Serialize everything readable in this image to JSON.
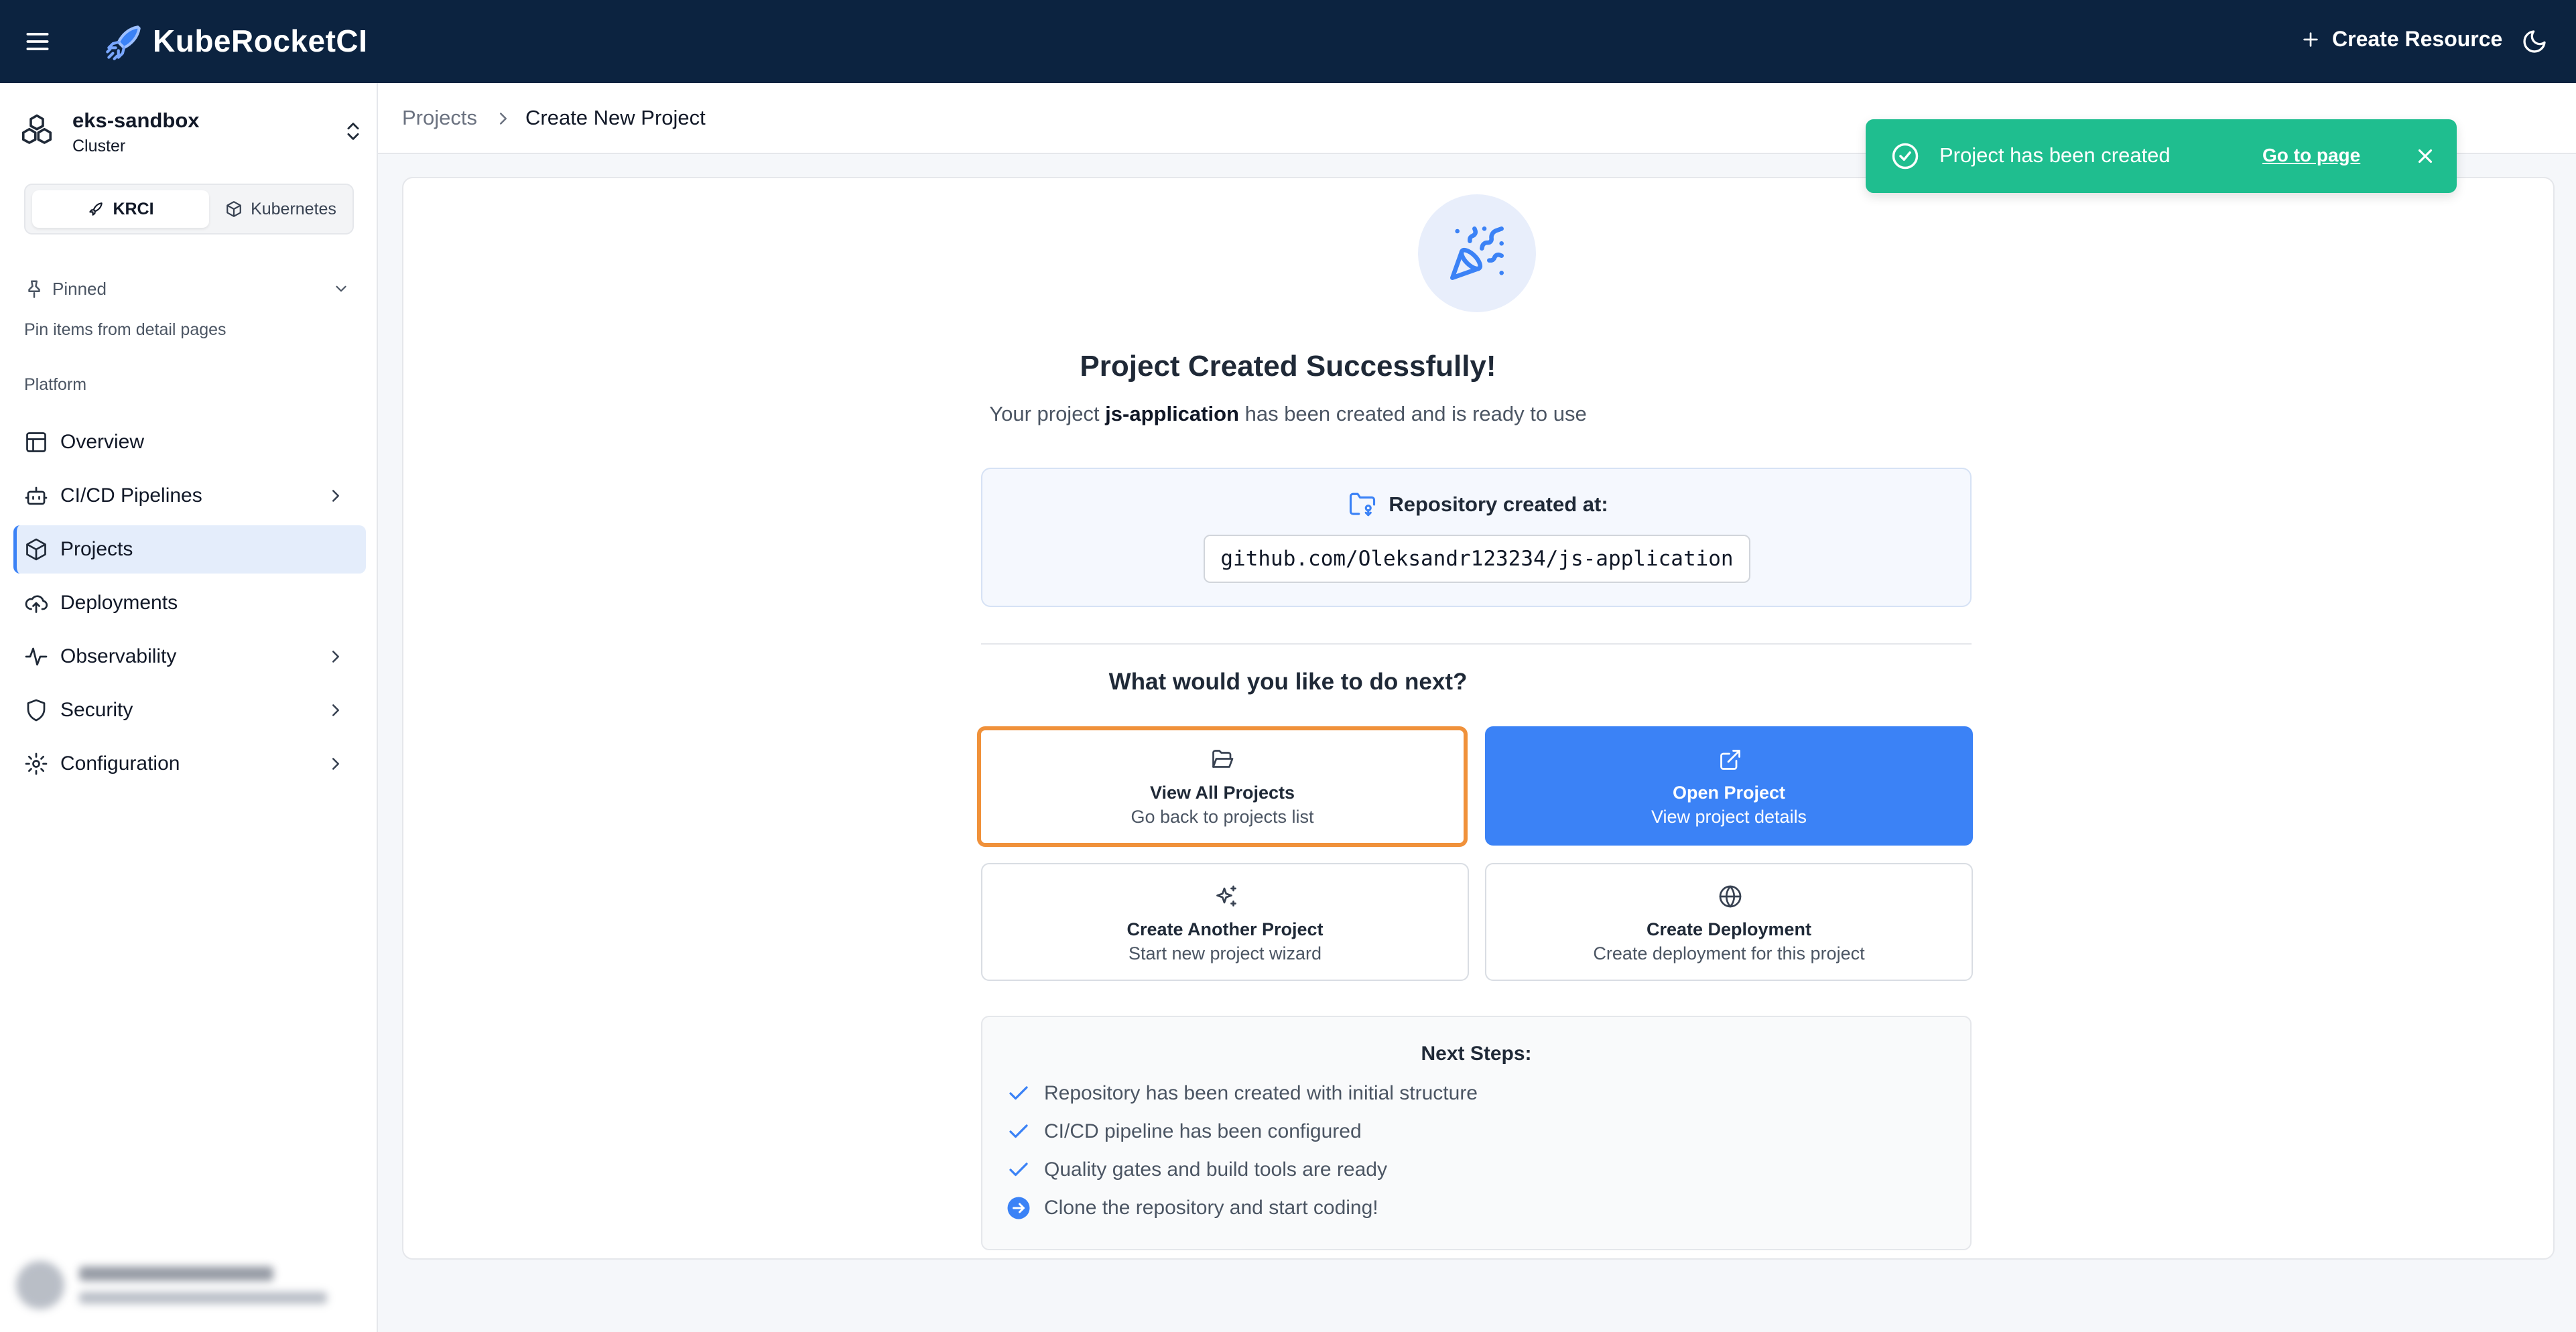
{
  "header": {
    "brand": "KubeRocketCI",
    "create_resource": "Create Resource"
  },
  "sidebar": {
    "cluster_name": "eks-sandbox",
    "cluster_sub": "Cluster",
    "mode_tabs": [
      "KRCI",
      "Kubernetes"
    ],
    "pinned_label": "Pinned",
    "pinned_hint": "Pin items from detail pages",
    "section_label": "Platform",
    "items": [
      {
        "label": "Overview",
        "icon": "layout-icon",
        "has_arrow": false
      },
      {
        "label": "CI/CD Pipelines",
        "icon": "bot-icon",
        "has_arrow": true
      },
      {
        "label": "Projects",
        "icon": "box-icon",
        "has_arrow": false,
        "active": true
      },
      {
        "label": "Deployments",
        "icon": "cloud-upload-icon",
        "has_arrow": false
      },
      {
        "label": "Observability",
        "icon": "activity-icon",
        "has_arrow": true
      },
      {
        "label": "Security",
        "icon": "shield-icon",
        "has_arrow": true
      },
      {
        "label": "Configuration",
        "icon": "gear-icon",
        "has_arrow": true
      }
    ]
  },
  "breadcrumb": {
    "parent": "Projects",
    "current": "Create New Project"
  },
  "success": {
    "title": "Project Created Successfully!",
    "sub_before": "Your project ",
    "project_name": "js-application",
    "sub_after": " has been created and is ready to use",
    "repo_label": "Repository created at:",
    "repo_url": "github.com/Oleksandr123234/js-application",
    "next_question": "What would you like to do next?"
  },
  "actions": [
    {
      "title": "View All Projects",
      "subtitle": "Go back to projects list",
      "icon": "folder-open-icon"
    },
    {
      "title": "Open Project",
      "subtitle": "View project details",
      "icon": "external-link-icon"
    },
    {
      "title": "Create Another Project",
      "subtitle": "Start new project wizard",
      "icon": "sparkles-icon"
    },
    {
      "title": "Create Deployment",
      "subtitle": "Create deployment for this project",
      "icon": "globe-icon"
    }
  ],
  "next_steps": {
    "title": "Next Steps:",
    "items": [
      {
        "text": "Repository has been created with initial structure",
        "status": "done"
      },
      {
        "text": "CI/CD pipeline has been configured",
        "status": "done"
      },
      {
        "text": "Quality gates and build tools are ready",
        "status": "done"
      },
      {
        "text": "Clone the repository and start coding!",
        "status": "todo"
      }
    ]
  },
  "toast": {
    "message": "Project has been created",
    "link": "Go to page"
  },
  "colors": {
    "topbar": "#0c2340",
    "accent": "#3b82f6",
    "toast": "#1fbe8f",
    "highlight": "#f0913a"
  }
}
